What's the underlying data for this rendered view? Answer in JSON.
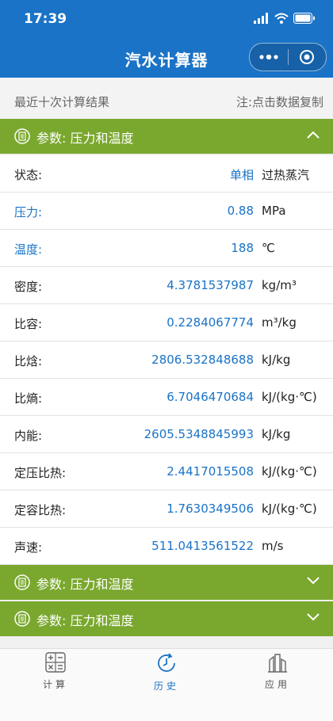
{
  "status_bar": {
    "time": "17:39"
  },
  "nav": {
    "title": "汽水计算器"
  },
  "recent": {
    "left": "最近十次计算结果",
    "right": "注:点击数据复制"
  },
  "sections": [
    {
      "label": "参数: 压力和温度",
      "expanded": true
    },
    {
      "label": "参数: 压力和温度",
      "expanded": false
    },
    {
      "label": "参数: 压力和温度",
      "expanded": false
    }
  ],
  "rows": [
    {
      "label": "状态:",
      "state": "单相",
      "state_desc": "过热蒸汽"
    },
    {
      "label": "压力:",
      "value": "0.88",
      "unit": "MPa"
    },
    {
      "label": "温度:",
      "value": "188",
      "unit": "℃"
    },
    {
      "label": "密度:",
      "value": "4.3781537987",
      "unit": "kg/m³"
    },
    {
      "label": "比容:",
      "value": "0.2284067774",
      "unit": "m³/kg"
    },
    {
      "label": "比焓:",
      "value": "2806.532848688",
      "unit": "kJ/kg"
    },
    {
      "label": "比熵:",
      "value": "6.7046470684",
      "unit": "kJ/(kg·℃)"
    },
    {
      "label": "内能:",
      "value": "2605.5348845993",
      "unit": "kJ/kg"
    },
    {
      "label": "定压比热:",
      "value": "2.4417015508",
      "unit": "kJ/(kg·℃)"
    },
    {
      "label": "定容比热:",
      "value": "1.7630349506",
      "unit": "kJ/(kg·℃)"
    },
    {
      "label": "声速:",
      "value": "511.0413561522",
      "unit": "m/s"
    }
  ],
  "tabs": [
    {
      "label": "计算",
      "icon": "calculator-icon",
      "active": false
    },
    {
      "label": "历史",
      "icon": "history-clock-icon",
      "active": true
    },
    {
      "label": "应用",
      "icon": "apps-icon",
      "active": false
    }
  ],
  "colors": {
    "primary": "#1a73c6",
    "section": "#7aa82e"
  }
}
